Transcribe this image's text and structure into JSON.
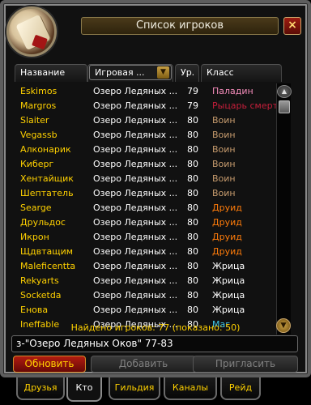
{
  "window": {
    "title": "Список игроков",
    "close_label": "×"
  },
  "columns": {
    "name": "Название",
    "zone_dropdown": "Игровая ...",
    "level": "Ур.",
    "class": "Класс"
  },
  "players": [
    {
      "name": "Eskimos",
      "zone": "Озеро Ледяных ...",
      "level": "79",
      "class": "Паладин",
      "class_color": "#f48cba"
    },
    {
      "name": "Margros",
      "zone": "Озеро Ледяных ...",
      "level": "79",
      "class": "Рыцарь смерти",
      "class_color": "#c41e3a"
    },
    {
      "name": "Slaiter",
      "zone": "Озеро Ледяных ...",
      "level": "80",
      "class": "Воин",
      "class_color": "#c69b6d"
    },
    {
      "name": "Vegassb",
      "zone": "Озеро Ледяных ...",
      "level": "80",
      "class": "Воин",
      "class_color": "#c69b6d"
    },
    {
      "name": "Алконарик",
      "zone": "Озеро Ледяных ...",
      "level": "80",
      "class": "Воин",
      "class_color": "#c69b6d"
    },
    {
      "name": "Киберг",
      "zone": "Озеро Ледяных ...",
      "level": "80",
      "class": "Воин",
      "class_color": "#c69b6d"
    },
    {
      "name": "Хентайщик",
      "zone": "Озеро Ледяных ...",
      "level": "80",
      "class": "Воин",
      "class_color": "#c69b6d"
    },
    {
      "name": "Шептатель",
      "zone": "Озеро Ледяных ...",
      "level": "80",
      "class": "Воин",
      "class_color": "#c69b6d"
    },
    {
      "name": "Searge",
      "zone": "Озеро Ледяных ...",
      "level": "80",
      "class": "Друид",
      "class_color": "#ff7c0a"
    },
    {
      "name": "Друльдос",
      "zone": "Озеро Ледяных ...",
      "level": "80",
      "class": "Друид",
      "class_color": "#ff7c0a"
    },
    {
      "name": "Икрон",
      "zone": "Озеро Ледяных ...",
      "level": "80",
      "class": "Друид",
      "class_color": "#ff7c0a"
    },
    {
      "name": "Щдвтащим",
      "zone": "Озеро Ледяных ...",
      "level": "80",
      "class": "Друид",
      "class_color": "#ff7c0a"
    },
    {
      "name": "Maleficentta",
      "zone": "Озеро Ледяных ...",
      "level": "80",
      "class": "Жрица",
      "class_color": "#ffffff"
    },
    {
      "name": "Rekyarts",
      "zone": "Озеро Ледяных ...",
      "level": "80",
      "class": "Жрица",
      "class_color": "#ffffff"
    },
    {
      "name": "Socketda",
      "zone": "Озеро Ледяных ...",
      "level": "80",
      "class": "Жрица",
      "class_color": "#ffffff"
    },
    {
      "name": "Енова",
      "zone": "Озеро Ледяных ...",
      "level": "80",
      "class": "Жрица",
      "class_color": "#ffffff"
    },
    {
      "name": "Ineffable",
      "zone": "Озеро Ледяных ...",
      "level": "80",
      "class": "Маг",
      "class_color": "#3fc7eb"
    }
  ],
  "footer": {
    "found_text": "Найдено игроков: 77  (показано: 50)"
  },
  "search": {
    "value": "з-\"Озеро Ледяных Оков\" 77-83"
  },
  "buttons": {
    "refresh": "Обновить",
    "add": "Добавить",
    "invite": "Пригласить"
  },
  "tabs": [
    {
      "label": "Друзья"
    },
    {
      "label": "Кто"
    },
    {
      "label": "Гильдия"
    },
    {
      "label": "Каналы"
    },
    {
      "label": "Рейд"
    }
  ],
  "colors": {
    "name_gold": "#ffd100",
    "accent_red": "#b01c10"
  }
}
